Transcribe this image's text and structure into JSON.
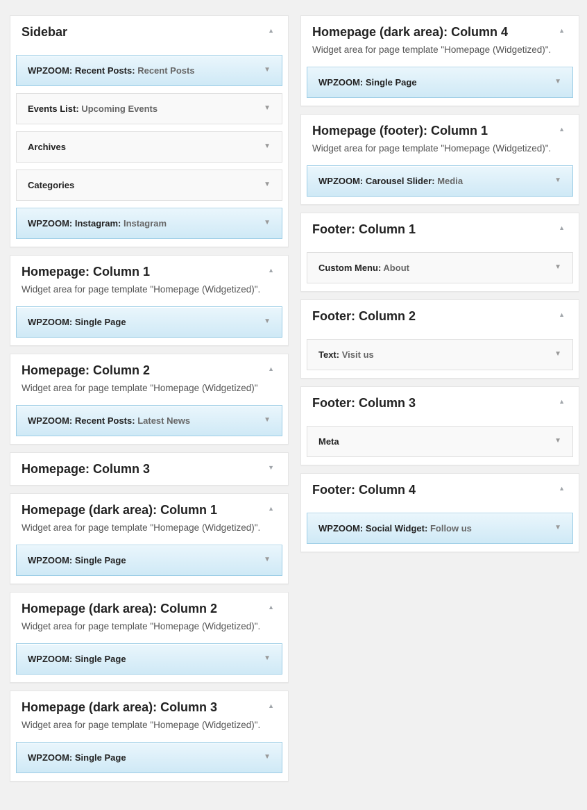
{
  "left_column": [
    {
      "title": "Sidebar",
      "description": "",
      "collapsed": false,
      "widgets": [
        {
          "name": "WPZOOM: Recent Posts:",
          "subtitle": "Recent Posts",
          "highlight": true
        },
        {
          "name": "Events List:",
          "subtitle": "Upcoming Events",
          "highlight": false
        },
        {
          "name": "Archives",
          "subtitle": "",
          "highlight": false
        },
        {
          "name": "Categories",
          "subtitle": "",
          "highlight": false
        },
        {
          "name": "WPZOOM: Instagram:",
          "subtitle": "Instagram",
          "highlight": true
        }
      ]
    },
    {
      "title": "Homepage: Column 1",
      "description": "Widget area for page template \"Homepage (Widgetized)\".",
      "collapsed": false,
      "widgets": [
        {
          "name": "WPZOOM: Single Page",
          "subtitle": "",
          "highlight": true
        }
      ]
    },
    {
      "title": "Homepage: Column 2",
      "description": "Widget area for page template \"Homepage (Widgetized)\"",
      "collapsed": false,
      "widgets": [
        {
          "name": "WPZOOM: Recent Posts:",
          "subtitle": "Latest News",
          "highlight": true
        }
      ]
    },
    {
      "title": "Homepage: Column 3",
      "description": "",
      "collapsed": true,
      "widgets": []
    },
    {
      "title": "Homepage (dark area): Column 1",
      "description": "Widget area for page template \"Homepage (Widgetized)\".",
      "collapsed": false,
      "widgets": [
        {
          "name": "WPZOOM: Single Page",
          "subtitle": "",
          "highlight": true
        }
      ]
    },
    {
      "title": "Homepage (dark area): Column 2",
      "description": "Widget area for page template \"Homepage (Widgetized)\".",
      "collapsed": false,
      "widgets": [
        {
          "name": "WPZOOM: Single Page",
          "subtitle": "",
          "highlight": true
        }
      ]
    },
    {
      "title": "Homepage (dark area): Column 3",
      "description": "Widget area for page template \"Homepage (Widgetized)\".",
      "collapsed": false,
      "widgets": [
        {
          "name": "WPZOOM: Single Page",
          "subtitle": "",
          "highlight": true
        }
      ]
    }
  ],
  "right_column": [
    {
      "title": "Homepage (dark area): Column 4",
      "description": "Widget area for page template \"Homepage (Widgetized)\".",
      "collapsed": false,
      "widgets": [
        {
          "name": "WPZOOM: Single Page",
          "subtitle": "",
          "highlight": true
        }
      ]
    },
    {
      "title": "Homepage (footer): Column 1",
      "description": "Widget area for page template \"Homepage (Widgetized)\".",
      "collapsed": false,
      "widgets": [
        {
          "name": "WPZOOM: Carousel Slider:",
          "subtitle": "Media",
          "highlight": true
        }
      ]
    },
    {
      "title": "Footer: Column 1",
      "description": "",
      "collapsed": false,
      "widgets": [
        {
          "name": "Custom Menu:",
          "subtitle": "About",
          "highlight": false
        }
      ]
    },
    {
      "title": "Footer: Column 2",
      "description": "",
      "collapsed": false,
      "widgets": [
        {
          "name": "Text:",
          "subtitle": "Visit us",
          "highlight": false
        }
      ]
    },
    {
      "title": "Footer: Column 3",
      "description": "",
      "collapsed": false,
      "widgets": [
        {
          "name": "Meta",
          "subtitle": "",
          "highlight": false
        }
      ]
    },
    {
      "title": "Footer: Column 4",
      "description": "",
      "collapsed": false,
      "widgets": [
        {
          "name": "WPZOOM: Social Widget:",
          "subtitle": "Follow us",
          "highlight": true
        }
      ]
    }
  ],
  "icons": {
    "area_expanded": "triangle-up-icon",
    "area_collapsed": "triangle-down-icon",
    "widget_toggle": "triangle-down-icon"
  },
  "colors": {
    "highlight_widget_bg": "#cfe9f6",
    "highlight_widget_border": "#9ccde6",
    "plain_widget_bg": "#f9f9f9",
    "page_bg": "#f1f1f1"
  }
}
